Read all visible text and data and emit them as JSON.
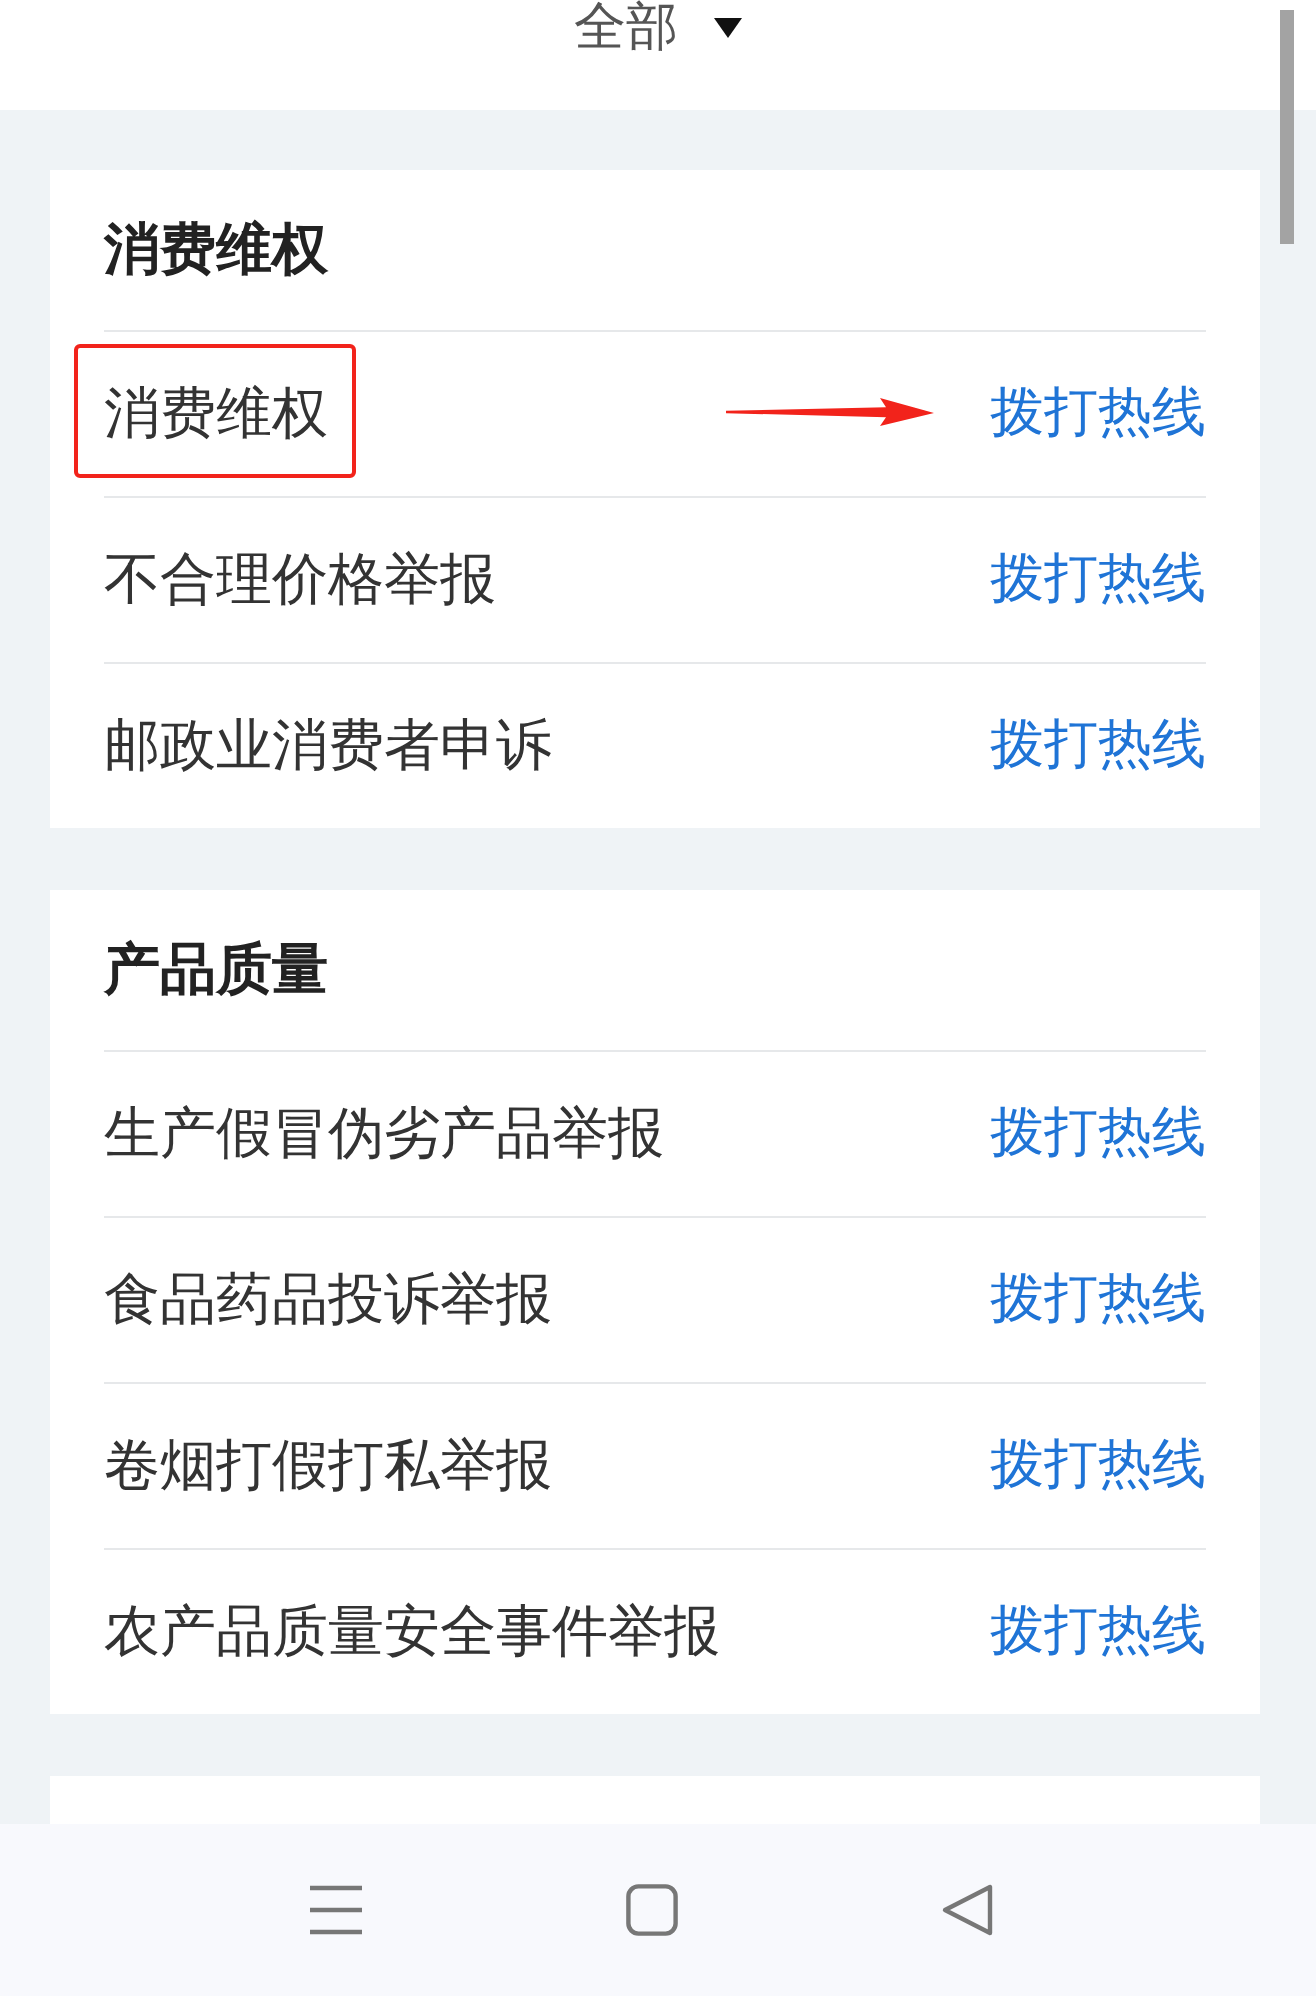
{
  "header": {
    "filter_label": "全部"
  },
  "sections": [
    {
      "title": "消费维权",
      "items": [
        {
          "name": "消费维权",
          "action": "拨打热线",
          "annotated": true
        },
        {
          "name": "不合理价格举报",
          "action": "拨打热线",
          "annotated": false
        },
        {
          "name": "邮政业消费者申诉",
          "action": "拨打热线",
          "annotated": false
        }
      ]
    },
    {
      "title": "产品质量",
      "items": [
        {
          "name": "生产假冒伪劣产品举报",
          "action": "拨打热线",
          "annotated": false
        },
        {
          "name": "食品药品投诉举报",
          "action": "拨打热线",
          "annotated": false
        },
        {
          "name": "卷烟打假打私举报",
          "action": "拨打热线",
          "annotated": false
        },
        {
          "name": "农产品质量安全事件举报",
          "action": "拨打热线",
          "annotated": false
        }
      ]
    }
  ]
}
